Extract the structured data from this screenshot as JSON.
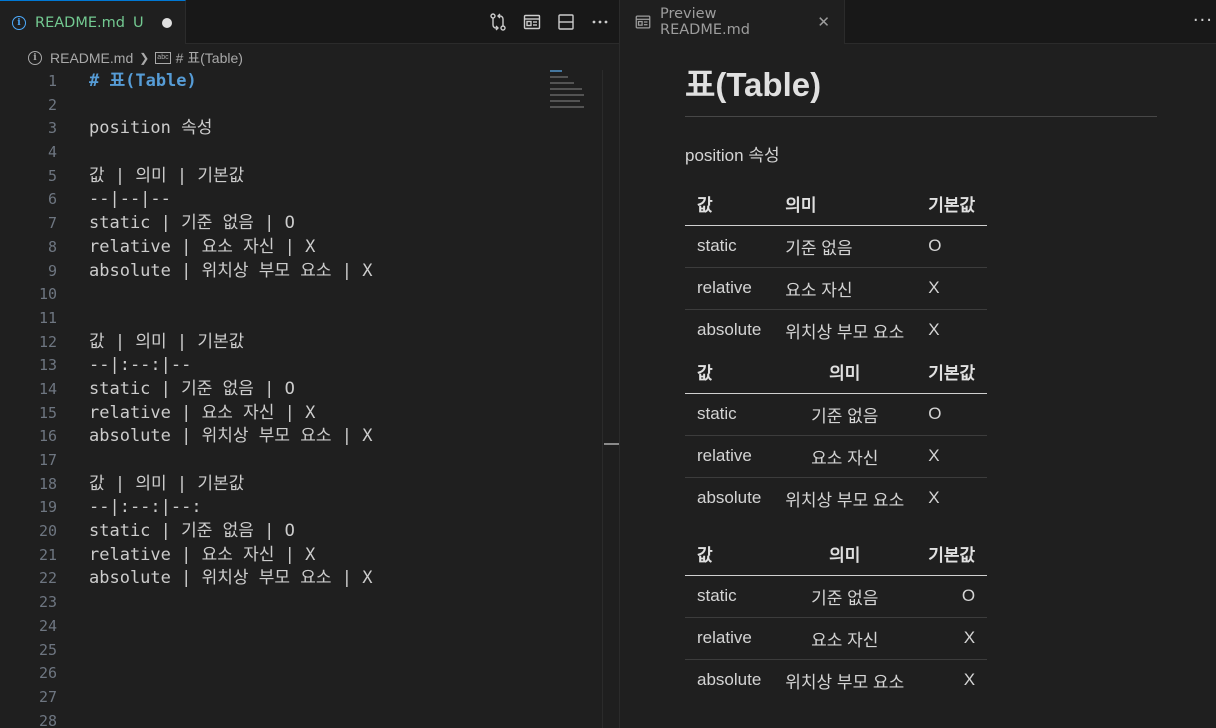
{
  "editor": {
    "tab": {
      "title": "README.md",
      "status": "U"
    },
    "breadcrumb": {
      "file": "README.md",
      "symbol": "# 표(Table)"
    },
    "lines": [
      {
        "n": "1",
        "text": "# 표(Table)"
      },
      {
        "n": "2",
        "text": ""
      },
      {
        "n": "3",
        "text": "position 속성"
      },
      {
        "n": "4",
        "text": ""
      },
      {
        "n": "5",
        "text": "값 | 의미 | 기본값"
      },
      {
        "n": "6",
        "text": "--|--|--"
      },
      {
        "n": "7",
        "text": "static | 기준 없음 | O"
      },
      {
        "n": "8",
        "text": "relative | 요소 자신 | X"
      },
      {
        "n": "9",
        "text": "absolute | 위치상 부모 요소 | X"
      },
      {
        "n": "10",
        "text": ""
      },
      {
        "n": "11",
        "text": ""
      },
      {
        "n": "12",
        "text": "값 | 의미 | 기본값"
      },
      {
        "n": "13",
        "text": "--|:--:|--"
      },
      {
        "n": "14",
        "text": "static | 기준 없음 | O"
      },
      {
        "n": "15",
        "text": "relative | 요소 자신 | X"
      },
      {
        "n": "16",
        "text": "absolute | 위치상 부모 요소 | X"
      },
      {
        "n": "17",
        "text": ""
      },
      {
        "n": "18",
        "text": "값 | 의미 | 기본값"
      },
      {
        "n": "19",
        "text": "--|:--:|--:"
      },
      {
        "n": "20",
        "text": "static | 기준 없음 | O"
      },
      {
        "n": "21",
        "text": "relative | 요소 자신 | X"
      },
      {
        "n": "22",
        "text": "absolute | 위치상 부모 요소 | X"
      },
      {
        "n": "23",
        "text": ""
      },
      {
        "n": "24",
        "text": ""
      },
      {
        "n": "25",
        "text": ""
      },
      {
        "n": "26",
        "text": ""
      },
      {
        "n": "27",
        "text": ""
      },
      {
        "n": "28",
        "text": ""
      }
    ]
  },
  "preview": {
    "tab": {
      "title": "Preview README.md"
    },
    "heading": "표(Table)",
    "paragraph": "position 속성",
    "tables": [
      {
        "headers": [
          "값",
          "의미",
          "기본값"
        ],
        "rows": [
          [
            "static",
            "기준 없음",
            "O"
          ],
          [
            "relative",
            "요소 자신",
            "X"
          ],
          [
            "absolute",
            "위치상 부모 요소",
            "X"
          ]
        ]
      },
      {
        "headers": [
          "값",
          "의미",
          "기본값"
        ],
        "rows": [
          [
            "static",
            "기준 없음",
            "O"
          ],
          [
            "relative",
            "요소 자신",
            "X"
          ],
          [
            "absolute",
            "위치상 부모 요소",
            "X"
          ]
        ]
      },
      {
        "headers": [
          "값",
          "의미",
          "기본값"
        ],
        "rows": [
          [
            "static",
            "기준 없음",
            "O"
          ],
          [
            "relative",
            "요소 자신",
            "X"
          ],
          [
            "absolute",
            "위치상 부모 요소",
            "X"
          ]
        ]
      }
    ]
  },
  "icons": {
    "tab_file": "info-icon",
    "toolbar": [
      "source-control-compare-icon",
      "open-preview-icon",
      "split-editor-icon",
      "more-actions-icon"
    ],
    "preview_tab": "preview-icon",
    "preview_close": "close-icon",
    "preview_more": "more-actions-icon"
  },
  "colors": {
    "accent": "#0078d4",
    "untracked": "#73c991",
    "heading_syntax": "#569cd6",
    "background": "#1f1f1f"
  }
}
